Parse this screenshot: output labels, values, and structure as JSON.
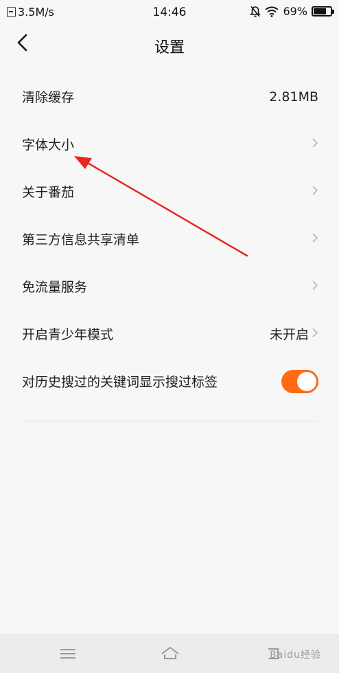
{
  "status_bar": {
    "net_speed": "3.5M/s",
    "time": "14:46",
    "battery": "69%"
  },
  "header": {
    "title": "设置"
  },
  "settings": {
    "items": [
      {
        "label": "清除缓存",
        "value": "2.81MB"
      },
      {
        "label": "字体大小"
      },
      {
        "label": "关于番茄"
      },
      {
        "label": "第三方信息共享清单"
      },
      {
        "label": "免流量服务"
      },
      {
        "label": "开启青少年模式",
        "value": "未开启"
      },
      {
        "label": "对历史搜过的关键词显示搜过标签",
        "toggle": true
      }
    ]
  },
  "nav_bar": {
    "watermark": "Baidu经验"
  },
  "colors": {
    "accent": "#ff6a13",
    "annotation": "#e8281e",
    "background": "#f7f7f7"
  }
}
